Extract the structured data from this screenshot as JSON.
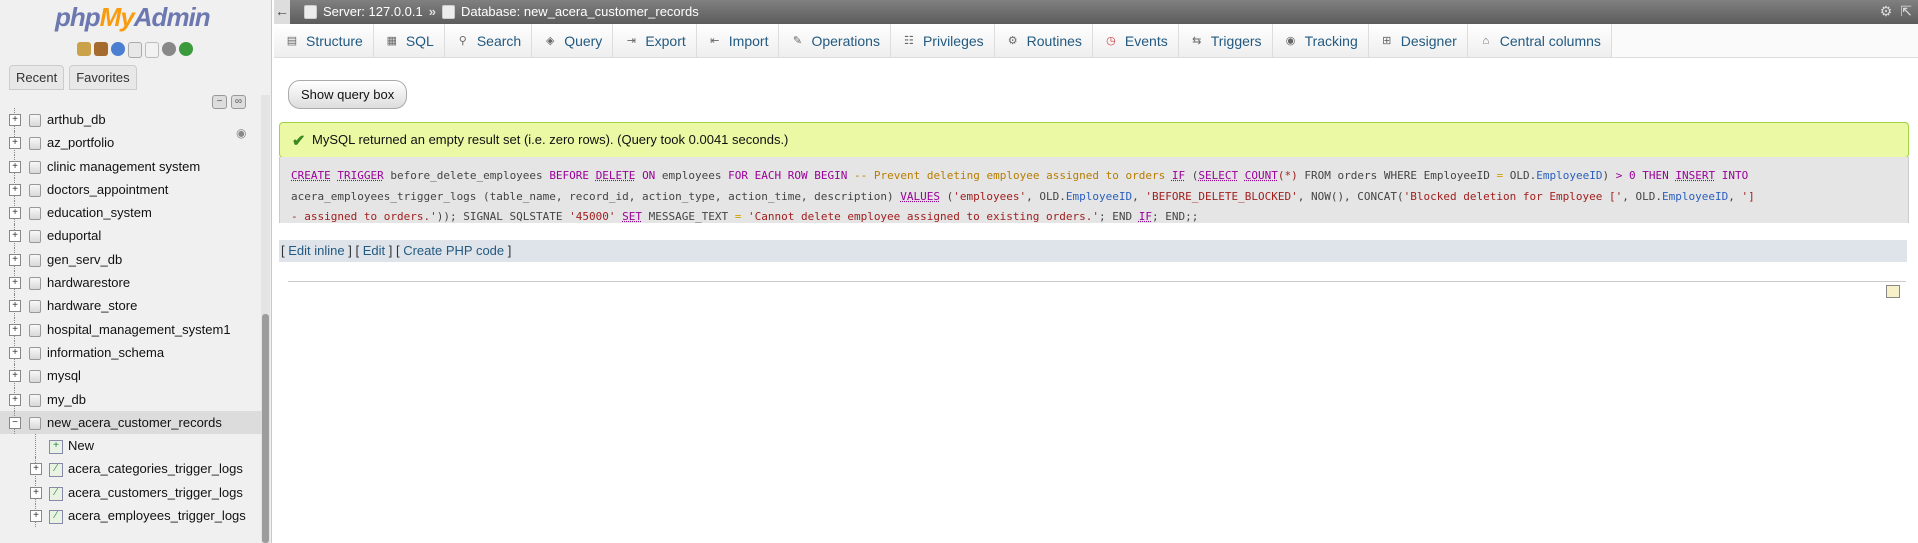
{
  "app": {
    "logo_php": "php",
    "logo_my": "My",
    "logo_admin": "Admin"
  },
  "left_tabs": [
    "Recent",
    "Favorites"
  ],
  "databases": [
    {
      "name": "arthub_db"
    },
    {
      "name": "az_portfolio"
    },
    {
      "name": "clinic management system"
    },
    {
      "name": "doctors_appointment"
    },
    {
      "name": "education_system"
    },
    {
      "name": "eduportal"
    },
    {
      "name": "gen_serv_db"
    },
    {
      "name": "hardwarestore"
    },
    {
      "name": "hardware_store"
    },
    {
      "name": "hospital_management_system1"
    },
    {
      "name": "information_schema"
    },
    {
      "name": "mysql"
    },
    {
      "name": "my_db"
    },
    {
      "name": "new_acera_customer_records"
    }
  ],
  "sub_items": [
    {
      "name": "New"
    },
    {
      "name": "acera_categories_trigger_logs"
    },
    {
      "name": "acera_customers_trigger_logs"
    },
    {
      "name": "acera_employees_trigger_logs"
    }
  ],
  "breadcrumb": {
    "server": "Server: 127.0.0.1",
    "separator": "»",
    "database": "Database: new_acera_customer_records"
  },
  "menu_tabs": [
    {
      "label": "Structure",
      "icon": "structure-icon"
    },
    {
      "label": "SQL",
      "icon": "sql-icon"
    },
    {
      "label": "Search",
      "icon": "search-icon"
    },
    {
      "label": "Query",
      "icon": "query-icon"
    },
    {
      "label": "Export",
      "icon": "export-icon"
    },
    {
      "label": "Import",
      "icon": "import-icon"
    },
    {
      "label": "Operations",
      "icon": "wrench-icon"
    },
    {
      "label": "Privileges",
      "icon": "privileges-icon"
    },
    {
      "label": "Routines",
      "icon": "routines-icon"
    },
    {
      "label": "Events",
      "icon": "clock-icon"
    },
    {
      "label": "Triggers",
      "icon": "triggers-icon"
    },
    {
      "label": "Tracking",
      "icon": "eye-icon"
    },
    {
      "label": "Designer",
      "icon": "designer-icon"
    },
    {
      "label": "Central columns",
      "icon": "columns-icon"
    }
  ],
  "show_query_box": "Show query box",
  "success_message": "MySQL returned an empty result set (i.e. zero rows). (Query took 0.0041 seconds.)",
  "sql": {
    "p1": "CREATE",
    "p2": "TRIGGER",
    "p3": " before_delete_employees ",
    "p4": "BEFORE",
    "p5": "DELETE",
    "p6": "ON",
    "p7": " employees ",
    "p8": "FOR EACH ROW BEGIN",
    "p9": " -- Prevent deleting employee assigned to orders ",
    "p10": "IF",
    "p11": "(",
    "p12": "SELECT",
    "p13": "COUNT",
    "p14": "(*)",
    "p15": " FROM orders WHERE EmployeeID ",
    "p16": "=",
    "p17": " OLD.",
    "p18": "EmployeeID",
    "p19": ") ",
    "p20": "> 0",
    "p21": " THEN ",
    "p22": "INSERT",
    "p23": "INTO",
    "line2a": "acera_employees_trigger_logs (table_name, record_id, action_type, action_time, description) ",
    "line2b": "VALUES",
    "line2c": " (",
    "line2d": "'employees'",
    "line2e": ", OLD.",
    "line2f": "EmployeeID",
    "line2g": ", ",
    "line2h": "'BEFORE_DELETE_BLOCKED'",
    "line2i": ", NOW(), CONCAT(",
    "line2j": "'Blocked deletion for Employee ['",
    "line2k": ", OLD.",
    "line2l": "EmployeeID",
    "line2m": ", ",
    "line2n": "']",
    "line3a": "- assigned to orders.'",
    "line3b": ")); SIGNAL SQLSTATE ",
    "line3c": "'45000'",
    "line3d": "SET",
    "line3e": " MESSAGE_TEXT ",
    "line3f": "=",
    "line3g": "'Cannot delete employee assigned to existing orders.'",
    "line3h": "; END ",
    "line3i": "IF",
    "line3j": "; END;;"
  },
  "tools": {
    "open1": "[",
    "edit_inline": "Edit inline",
    "mid1": "] [",
    "edit": "Edit",
    "mid2": "] [",
    "create_php": "Create PHP code",
    "close": "]"
  }
}
